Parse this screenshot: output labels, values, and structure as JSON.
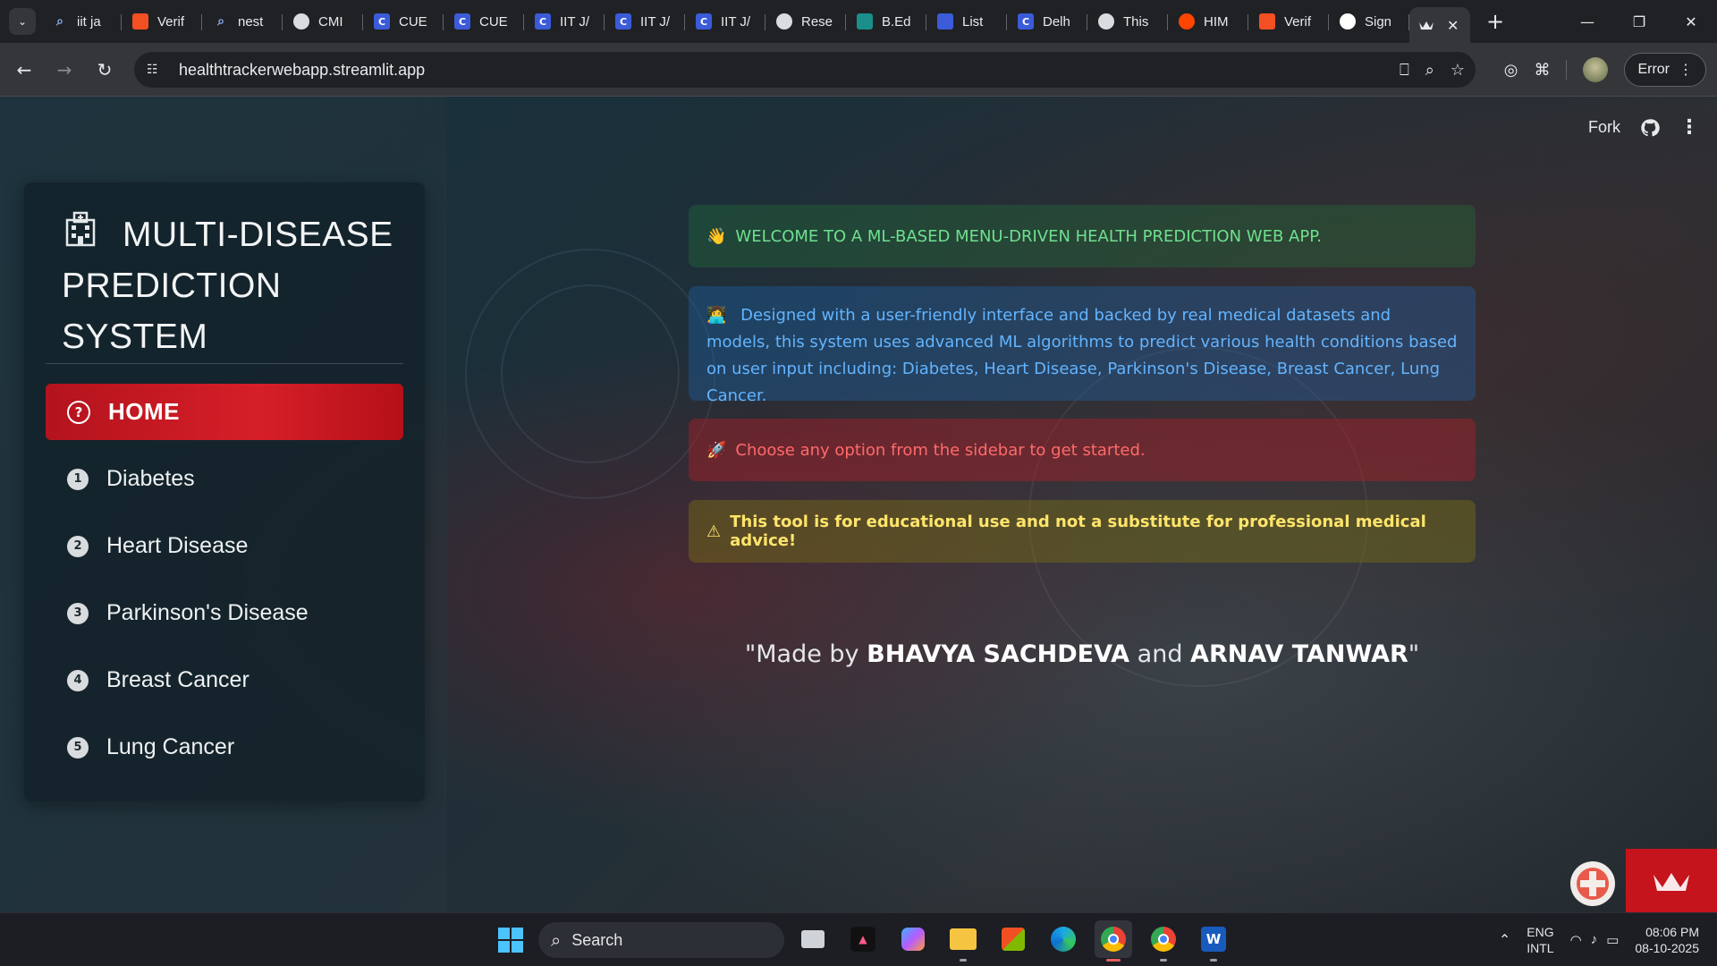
{
  "browser": {
    "tabs": [
      {
        "title": "iit ja",
        "icon": "search-icon",
        "color": "#8ab4f8"
      },
      {
        "title": "Verif",
        "icon": "microsoft-icon",
        "color": "#f25022"
      },
      {
        "title": "nest",
        "icon": "search-icon",
        "color": "#8ab4f8"
      },
      {
        "title": "CMI",
        "icon": "globe-icon",
        "color": "#5f6368"
      },
      {
        "title": "CUE",
        "icon": "c-icon",
        "color": "#3b5bd9"
      },
      {
        "title": "CUE",
        "icon": "c-icon",
        "color": "#3b5bd9"
      },
      {
        "title": "IIT J/",
        "icon": "c-icon",
        "color": "#3b5bd9"
      },
      {
        "title": "IIT J/",
        "icon": "c-icon",
        "color": "#3b5bd9"
      },
      {
        "title": "IIT J/",
        "icon": "c-icon",
        "color": "#3b5bd9"
      },
      {
        "title": "Rese",
        "icon": "openai-icon",
        "color": "#5f6368"
      },
      {
        "title": "B.Ed",
        "icon": "vedantu-icon",
        "color": "#1a8f8a"
      },
      {
        "title": "List",
        "icon": "list-icon",
        "color": "#3b5bd9"
      },
      {
        "title": "Delh",
        "icon": "c-icon",
        "color": "#3b5bd9"
      },
      {
        "title": "This",
        "icon": "globe-icon",
        "color": "#5f6368"
      },
      {
        "title": "HIM",
        "icon": "reddit-icon",
        "color": "#ff4500"
      },
      {
        "title": "Verif",
        "icon": "microsoft-icon",
        "color": "#f25022"
      },
      {
        "title": "Sign",
        "icon": "google-icon",
        "color": "#ffffff"
      }
    ],
    "url": "healthtrackerwebapp.streamlit.app",
    "error_label": "Error"
  },
  "sidebar": {
    "title": "MULTI-DISEASE PREDICTION SYSTEM",
    "items": [
      {
        "num": "?",
        "label": "HOME",
        "active": true
      },
      {
        "num": "1",
        "label": "Diabetes"
      },
      {
        "num": "2",
        "label": "Heart Disease"
      },
      {
        "num": "3",
        "label": "Parkinson's Disease"
      },
      {
        "num": "4",
        "label": "Breast Cancer"
      },
      {
        "num": "5",
        "label": "Lung Cancer"
      }
    ]
  },
  "toolbar": {
    "fork_label": "Fork"
  },
  "main": {
    "welcome_emoji": "👋",
    "welcome": "WELCOME TO A ML-BASED MENU-DRIVEN HEALTH PREDICTION WEB APP.",
    "info_emoji": "👩‍💻",
    "info": "Designed with a user-friendly interface and backed by real medical datasets and models, this system uses advanced ML algorithms to predict various health conditions based on user input including: Diabetes, Heart Disease, Parkinson's Disease, Breast Cancer, Lung Cancer.",
    "start_emoji": "🚀",
    "start": "Choose any option from the sidebar to get started.",
    "warn_emoji": "⚠",
    "warning": "This tool is for educational use and not a substitute for professional medical advice!",
    "credits_prefix": "\"Made by ",
    "author1": "BHAVYA SACHDEVA",
    "credits_and": " and ",
    "author2": "ARNAV TANWAR",
    "credits_suffix": "\""
  },
  "taskbar": {
    "search_label": "Search",
    "lang_top": "ENG",
    "lang_bottom": "INTL",
    "time": "08:06 PM",
    "date": "08-10-2025"
  },
  "colors": {
    "accent_red": "#d61f28",
    "success_text": "#6fe08e",
    "info_text": "#63b4ff",
    "error_text": "#ff6a6a",
    "warning_text": "#ffe56b"
  }
}
